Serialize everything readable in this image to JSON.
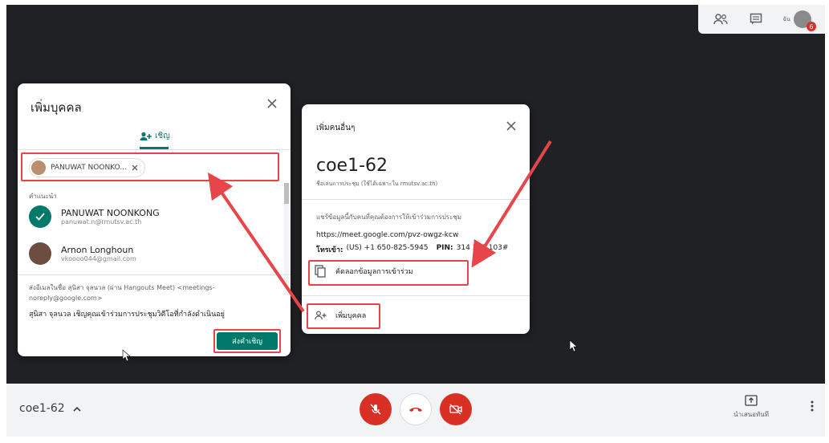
{
  "topbar": {
    "people_icon": "people-icon",
    "chat_icon": "chat-icon",
    "meta_text": "ฉัน",
    "badge": "6"
  },
  "add_people_dialog": {
    "title": "เพิ่มบุคคล",
    "tab_label": "เชิญ",
    "chip_label": "PANUWAT NOONKO...",
    "suggestions_label": "คำแนะนำ",
    "suggestions": [
      {
        "name": "PANUWAT NOONKONG",
        "email": "panuwat.n@rmutsv.ac.th"
      },
      {
        "name": "Arnon Longhoun",
        "email": "vkoooo044@gmail.com"
      }
    ],
    "sender_note": "ส่งอีเมลในชื่อ สุนิสา จุลนวล (ผ่าน Hangouts Meet) <meetings-noreply@google.com>",
    "invite_message": "สุนิสา จุลนวล เชิญคุณเข้าร่วมการประชุมวิดีโอที่กำลังดำเนินอยู่",
    "send_button": "ส่งคำเชิญ"
  },
  "others_dialog": {
    "title": "เพิ่มคนอื่นๆ",
    "meeting_code": "coe1-62",
    "meeting_code_note": "ชื่อเล่นการประชุม (ใช้ได้เฉพาะใน rmutsv.ac.th)",
    "share_info": "แชร์ข้อมูลนี้กับคนที่คุณต้องการให้เข้าร่วมการประชุม",
    "link": "https://meet.google.com/pvz-owgz-kcw",
    "phone_prefix": "โทรเข้า:",
    "phone": "(US) +1 650-825-5945",
    "pin_label": "PIN:",
    "pin": "314 337 103#",
    "copy_button": "คัดลอกข้อมูลการเข้าร่วม",
    "add_people_button": "เพิ่มบุคคล"
  },
  "bottombar": {
    "meeting_code": "coe1-62",
    "present_label": "นำเสนอทันที"
  },
  "colors": {
    "accent": "#00796b",
    "highlight": "#e8454a",
    "end_call": "#d93025"
  }
}
